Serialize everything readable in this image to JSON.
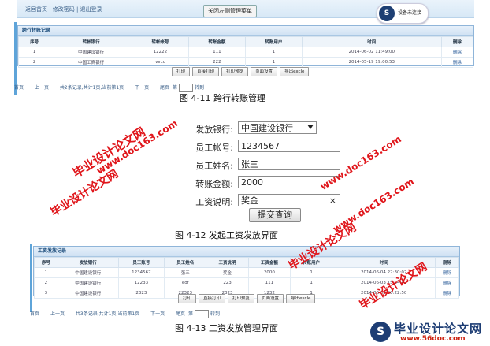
{
  "fig1": {
    "nav_text": "返回首页 | 修改密码 | 退出登录",
    "close_menu_button": "关闭左侧管理菜单",
    "connection": {
      "badge": "S",
      "status": "设备未连接"
    },
    "panel_title": "跨行转账记录",
    "columns": [
      "序号",
      "转帐银行",
      "转帐帐号",
      "转账金额",
      "转账用户",
      "时间",
      "删除"
    ],
    "rows": [
      [
        "1",
        "中国建设银行",
        "12222",
        "111",
        "1",
        "2014-06-02 11:49:00",
        "删除"
      ],
      [
        "2",
        "中国工商银行",
        "vvcc",
        "222",
        "1",
        "2014-05-19 19:00:53",
        "删除"
      ]
    ],
    "buttons": [
      "打印",
      "直接打印",
      "打印预览",
      "页面设置",
      "导出excle"
    ],
    "pager": {
      "first": "首页",
      "prev": "上一页",
      "summary": "共2条记录,共计1页,当前第1页",
      "next": "下一页",
      "last": "尾页",
      "goto": "第",
      "suffix": "转到"
    },
    "caption": "图 4-11  跨行转账管理"
  },
  "form": {
    "fields": [
      {
        "label": "发放银行:",
        "value": "中国建设银行",
        "type": "select"
      },
      {
        "label": "员工帐号:",
        "value": "1234567",
        "type": "text"
      },
      {
        "label": "员工姓名:",
        "value": "张三",
        "type": "text"
      },
      {
        "label": "转账金额:",
        "value": "2000",
        "type": "text"
      },
      {
        "label": "工资说明:",
        "value": "奖金",
        "type": "text-clear"
      }
    ],
    "clear_glyph": "×",
    "submit": "提交查询",
    "caption": "图 4-12  发起工资发放界面"
  },
  "fig3": {
    "panel_title": "工资发放记录",
    "columns": [
      "序号",
      "发放银行",
      "员工账号",
      "员工姓名",
      "工资说明",
      "工资金额",
      "转账用户",
      "时间",
      "删除"
    ],
    "rows": [
      [
        "1",
        "中国建设银行",
        "1234567",
        "张三",
        "奖金",
        "2000",
        "1",
        "2014-06-04 22:30:02",
        "删除"
      ],
      [
        "2",
        "中国建设银行",
        "12233",
        "edf",
        "223",
        "111",
        "1",
        "2014-06-03 15:04:42",
        "删除"
      ],
      [
        "3",
        "中国建设银行",
        "2323",
        "22323",
        "2323",
        "1232",
        "1",
        "2014-06-03 00:22:50",
        "删除"
      ]
    ],
    "buttons": [
      "打印",
      "直接打印",
      "打印预览",
      "页面设置",
      "导出excle"
    ],
    "pager": {
      "first": "首页",
      "prev": "上一页",
      "summary": "共3条记录,共计1页,当前第1页",
      "next": "下一页",
      "last": "尾页",
      "goto": "第",
      "suffix": "转到"
    },
    "caption": "图 4-13  工资发放管理界面"
  },
  "watermarks": {
    "top_cn": "毕业设计论文网",
    "top_url": "www.doc163.com",
    "right_url": "www.doc163.com",
    "left_cn": "毕业设计论文网",
    "left_url": "www.doc163.com",
    "right_cn": "毕业设计论文网",
    "mid_cn": "毕业设计论文网",
    "logo_badge": "S",
    "logo_cn": "毕业设计论文网",
    "logo_url": "www.56doc.com"
  },
  "colors": {
    "accent": "#1d3d74",
    "watermark": "#e0151a",
    "panel_border": "#8fb5d9"
  }
}
